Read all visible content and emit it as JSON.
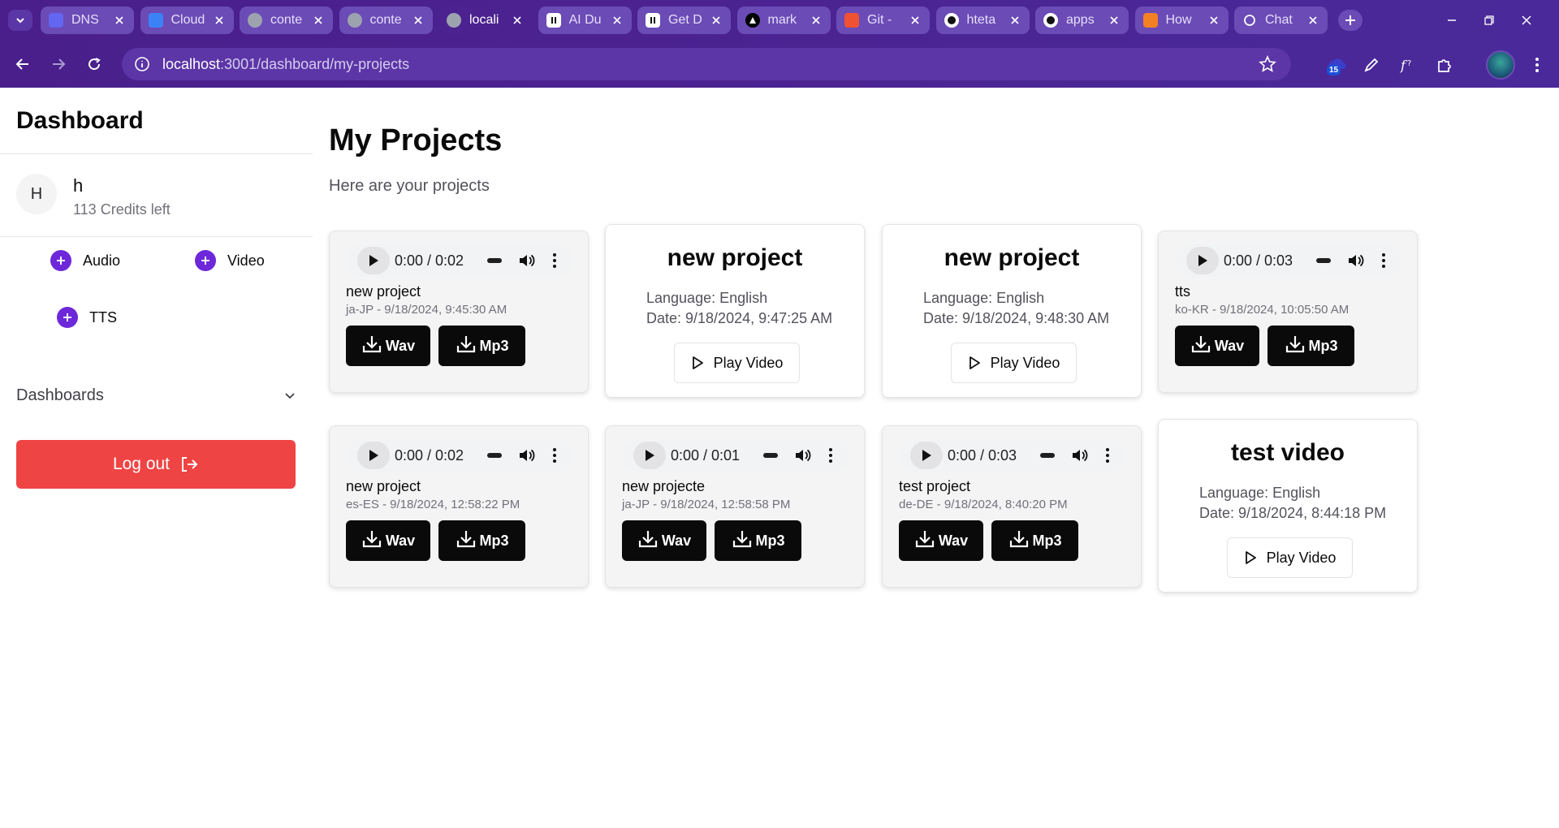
{
  "browser": {
    "tabs": [
      {
        "title": "DNS",
        "favicon": "dns-favicon",
        "color": "#6366f1"
      },
      {
        "title": "Cloud",
        "favicon": "cloud-favicon",
        "color": "#3b82f6"
      },
      {
        "title": "conte",
        "favicon": "globe-favicon",
        "color": "#9ca3af"
      },
      {
        "title": "conte",
        "favicon": "globe-favicon",
        "color": "#9ca3af"
      },
      {
        "title": "locali",
        "favicon": "globe-favicon",
        "color": "#9ca3af"
      },
      {
        "title": "AI Du",
        "favicon": "pause-favicon",
        "color": "#ffffff"
      },
      {
        "title": "Get D",
        "favicon": "pause-favicon",
        "color": "#ffffff"
      },
      {
        "title": "mark",
        "favicon": "triangle-favicon",
        "color": "#000000"
      },
      {
        "title": "Git -",
        "favicon": "git-favicon",
        "color": "#f05133"
      },
      {
        "title": "hteta",
        "favicon": "github-favicon",
        "color": "#ffffff"
      },
      {
        "title": "apps",
        "favicon": "github-favicon",
        "color": "#ffffff"
      },
      {
        "title": "How",
        "favicon": "stackoverflow-favicon",
        "color": "#f48024"
      },
      {
        "title": "Chat",
        "favicon": "chatgpt-favicon",
        "color": "#ffffff"
      }
    ],
    "active_tab_index": 4,
    "url_host": "localhost",
    "url_path": ":3001/dashboard/my-projects",
    "extension_badge": "15"
  },
  "sidebar": {
    "title": "Dashboard",
    "user": {
      "initial": "H",
      "name": "h",
      "credits": "113 Credits left"
    },
    "create": [
      {
        "label": "Audio"
      },
      {
        "label": "Video"
      },
      {
        "label": "TTS"
      }
    ],
    "dashboards_label": "Dashboards",
    "logout_label": "Log out"
  },
  "main": {
    "title": "My Projects",
    "subtitle": "Here are your projects",
    "wav_label": "Wav",
    "mp3_label": "Mp3",
    "play_video_label": "Play Video",
    "projects": [
      {
        "kind": "audio",
        "time": "0:00 / 0:02",
        "title": "new project",
        "meta": "ja-JP - 9/18/2024, 9:45:30 AM"
      },
      {
        "kind": "video",
        "title": "new project",
        "language": "Language: English",
        "date": "Date: 9/18/2024, 9:47:25 AM"
      },
      {
        "kind": "video",
        "title": "new project",
        "language": "Language: English",
        "date": "Date: 9/18/2024, 9:48:30 AM"
      },
      {
        "kind": "audio",
        "time": "0:00 / 0:03",
        "title": "tts",
        "meta": "ko-KR - 9/18/2024, 10:05:50 AM"
      },
      {
        "kind": "audio",
        "time": "0:00 / 0:02",
        "title": "new project",
        "meta": "es-ES - 9/18/2024, 12:58:22 PM"
      },
      {
        "kind": "audio",
        "time": "0:00 / 0:01",
        "title": "new projecte",
        "meta": "ja-JP - 9/18/2024, 12:58:58 PM"
      },
      {
        "kind": "audio",
        "time": "0:00 / 0:03",
        "title": "test project",
        "meta": "de-DE - 9/18/2024, 8:40:20 PM"
      },
      {
        "kind": "video",
        "title": "test video",
        "language": "Language: English",
        "date": "Date: 9/18/2024, 8:44:18 PM"
      }
    ]
  }
}
